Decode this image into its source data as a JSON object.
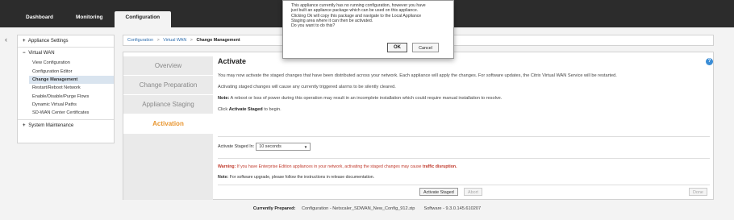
{
  "top_nav": {
    "dashboard": "Dashboard",
    "monitoring": "Monitoring",
    "configuration": "Configuration"
  },
  "sidebar": {
    "appliance_settings": "Appliance Settings",
    "virtual_wan": "Virtual WAN",
    "items": [
      "View Configuration",
      "Configuration Editor",
      "Change Management",
      "Restart/Reboot Network",
      "Enable/Disable/Purge Flows",
      "Dynamic Virtual Paths",
      "SD-WAN Center Certificates"
    ],
    "system_maintenance": "System Maintenance"
  },
  "breadcrumb": {
    "configuration": "Configuration",
    "virtual_wan": "Virtual WAN",
    "current": "Change Management"
  },
  "steps": [
    "Overview",
    "Change Preparation",
    "Appliance Staging",
    "Activation"
  ],
  "content": {
    "title": "Activate",
    "p1": "You may now activate the staged changes that have been distributed across your network. Each appliance will apply the changes. For software updates, the Citrix Virtual WAN Service will be restarted.",
    "p2": "Activating staged changes will cause any currently triggered alarms to be silently cleared.",
    "note_label": "Note:",
    "note_text": "A reboot or loss of power during this operation may result in an incomplete installation which could require manual installation to resolve.",
    "click_prefix": "Click",
    "click_bold": "Activate Staged",
    "click_suffix": "to begin.",
    "activate_in_label": "Activate Staged In:",
    "activate_in_value": "10 seconds",
    "warning_label": "Warning:",
    "warning_text": "If you have Enterprise Edition appliances in your network, activating the staged changes may cause",
    "warning_bold": "traffic disruption.",
    "note2_label": "Note:",
    "note2_text": "For software upgrade, please follow the instructions in release documentation.",
    "btn_activate": "Activate Staged",
    "btn_abort": "Abort",
    "btn_done": "Done"
  },
  "footer": {
    "label": "Currently Prepared:",
    "config": "Configuration - Netscaler_SDWAN_New_Config_912.zip",
    "software": "Software - 9.3.0.145.610207"
  },
  "dialog": {
    "text": "This appliance currently has no running configuration, however you have\njust built an appliance package which can be used on this appliance.\nClicking Ok will copy this package and navigate to the Local Appliance\nStaging area where it can then be activated.\nDo you want to do this?",
    "ok": "OK",
    "cancel": "Cancel"
  },
  "colors": {
    "accent": "#e8952f",
    "link": "#2f6eae",
    "warning": "#c0392b",
    "topbar": "#2c2c2c"
  }
}
